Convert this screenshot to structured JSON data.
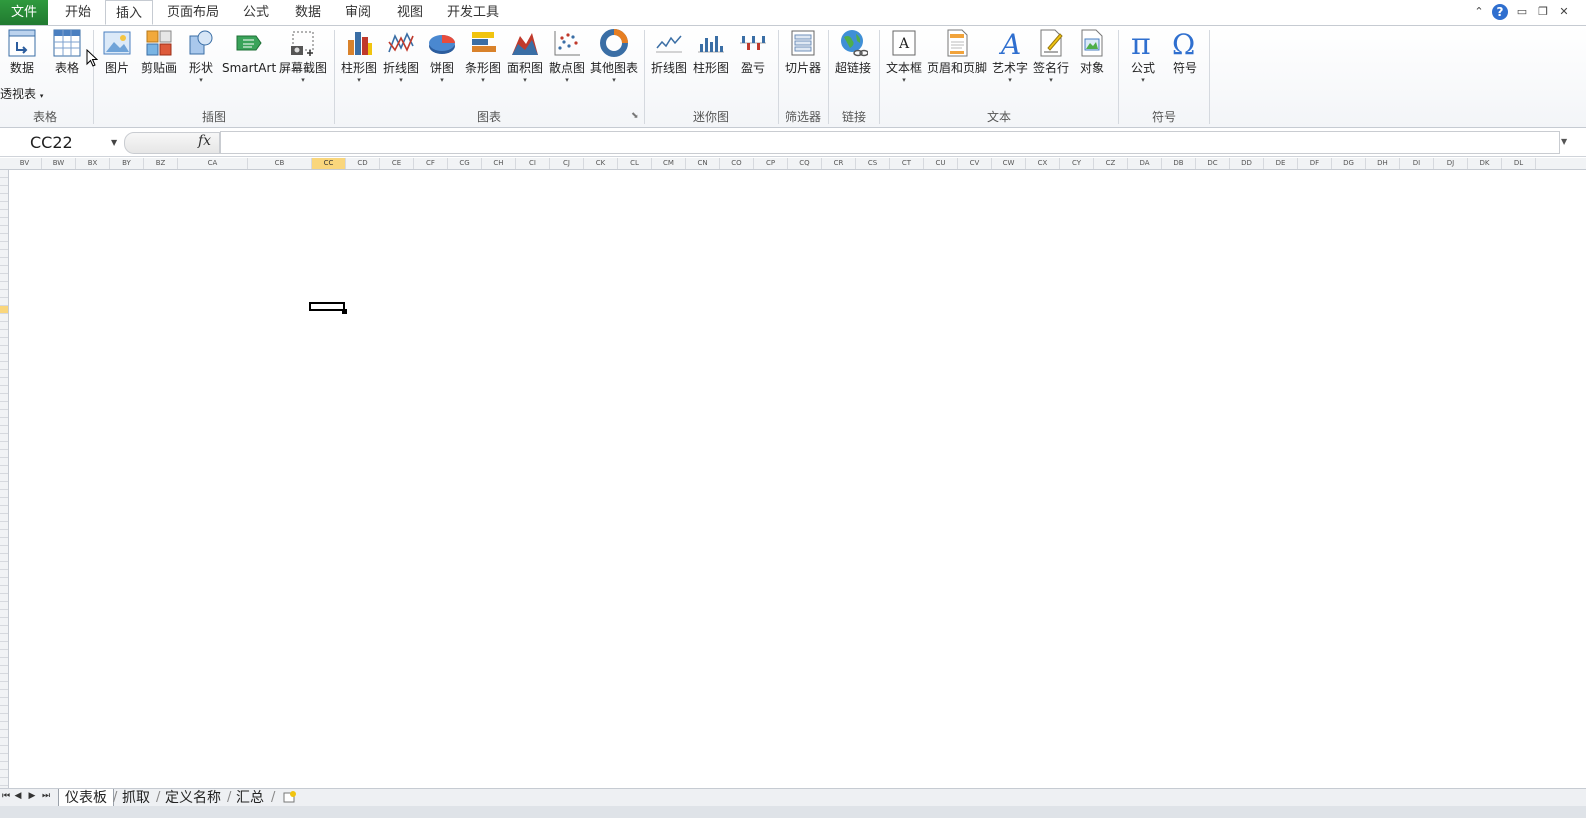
{
  "tabs": {
    "file": "文件",
    "home": "开始",
    "insert": "插入",
    "page_layout": "页面布局",
    "formulas": "公式",
    "data": "数据",
    "review": "审阅",
    "view": "视图",
    "developer": "开发工具",
    "active": "插入"
  },
  "ribbon": {
    "groups": {
      "tables": "表格",
      "illustrations": "插图",
      "charts": "图表",
      "sparklines": "迷你图",
      "filter": "筛选器",
      "links": "链接",
      "text": "文本",
      "symbols": "符号"
    },
    "buttons": {
      "pivot_line1": "数据",
      "pivot_line2": "透视表",
      "table": "表格",
      "picture": "图片",
      "clipart": "剪贴画",
      "shapes": "形状",
      "smartart": "SmartArt",
      "screenshot": "屏幕截图",
      "column_chart": "柱形图",
      "line_chart": "折线图",
      "pie_chart": "饼图",
      "bar_chart": "条形图",
      "area_chart": "面积图",
      "scatter_chart": "散点图",
      "other_charts": "其他图表",
      "spark_line": "折线图",
      "spark_column": "柱形图",
      "spark_winloss": "盈亏",
      "slicer": "切片器",
      "hyperlink": "超链接",
      "textbox": "文本框",
      "header_footer": "页眉和页脚",
      "wordart": "艺术字",
      "signature": "签名行",
      "object": "对象",
      "equation": "公式",
      "symbol": "符号"
    }
  },
  "formula_bar": {
    "name_box": "CC22",
    "fx": "fx",
    "formula": ""
  },
  "grid": {
    "columns": [
      "BV",
      "BW",
      "BX",
      "BY",
      "BZ",
      "CA",
      "CB",
      "CC",
      "CD",
      "CE",
      "CF",
      "CG",
      "CH",
      "CI",
      "CJ",
      "CK",
      "CL",
      "CM",
      "CN",
      "CO",
      "CP",
      "CQ",
      "CR",
      "CS",
      "CT",
      "CU",
      "CV",
      "CW",
      "CX",
      "CY",
      "CZ",
      "DA",
      "DB",
      "DC",
      "DD",
      "DE",
      "DF",
      "DG",
      "DH",
      "DI",
      "DJ",
      "DK",
      "DL"
    ],
    "selected_column": "CC",
    "selected_row": "22",
    "accent": "#f9d67c"
  },
  "sheets": {
    "tabs": [
      "仪表板",
      "抓取",
      "定义名称",
      "汇总"
    ],
    "active": "仪表板"
  },
  "colors": {
    "file_tab": "#217a30",
    "help": "#2f6fcf"
  }
}
